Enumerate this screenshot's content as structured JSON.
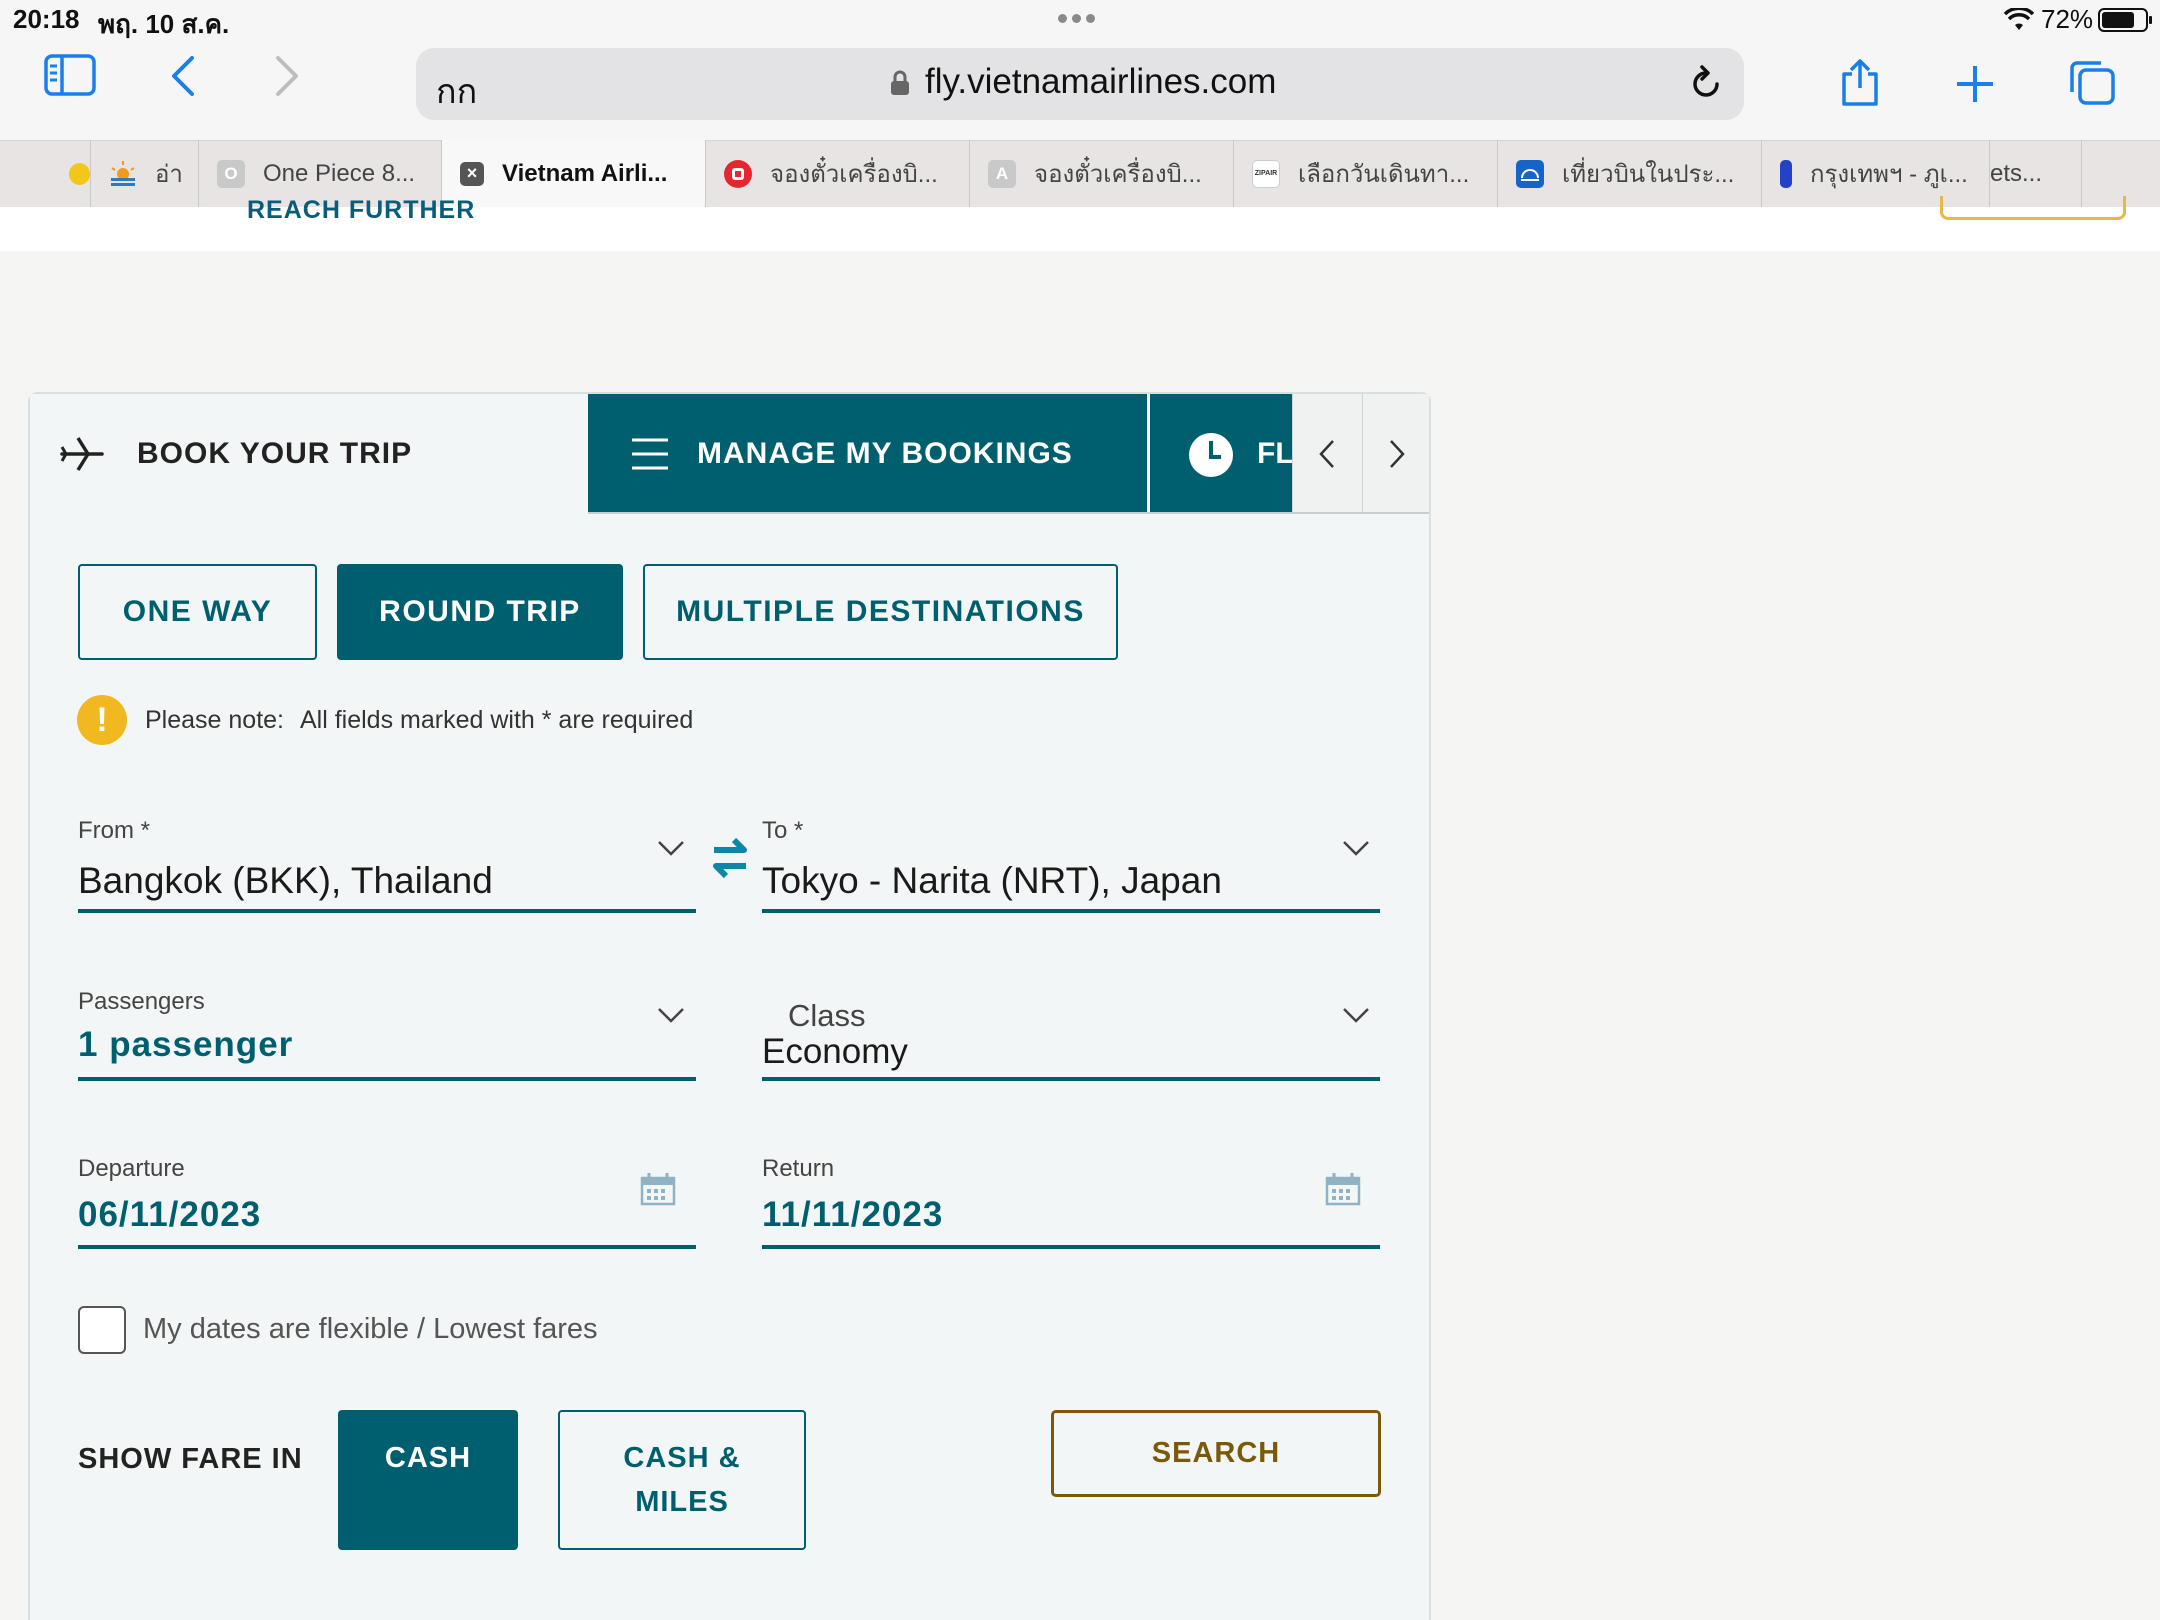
{
  "status_bar": {
    "time": "20:18",
    "date": "พฤ. 10 ส.ค.",
    "battery": "72%"
  },
  "browser": {
    "reader_label": "กก",
    "url": "fly.vietnamairlines.com",
    "tabs": [
      {
        "label": "อ่า",
        "favicon": "sun-icon"
      },
      {
        "label": "One Piece 8...",
        "favicon": "O"
      },
      {
        "label": "Vietnam Airli...",
        "favicon": "close-icon",
        "active": true
      },
      {
        "label": "จองตั๋วเครื่องบิ...",
        "favicon": "red-logo"
      },
      {
        "label": "จองตั๋วเครื่องบิ...",
        "favicon": "A"
      },
      {
        "label": "เลือกวันเดินทา...",
        "favicon": "zipair-logo"
      },
      {
        "label": "เที่ยวบินในประ...",
        "favicon": "blue-logo"
      },
      {
        "label": "กรุงเทพฯ - ภูเ...",
        "favicon": "flag-logo"
      },
      {
        "label": "ets...",
        "favicon": ""
      }
    ]
  },
  "header": {
    "tagline": "REACH FURTHER"
  },
  "widget": {
    "tabs": {
      "book": "BOOK YOUR TRIP",
      "manage": "MANAGE MY BOOKINGS",
      "flight": "FL"
    },
    "trip_types": {
      "one_way": "ONE WAY",
      "round_trip": "ROUND TRIP",
      "multi": "MULTIPLE DESTINATIONS"
    },
    "note": {
      "label": "Please note:",
      "text": "All fields marked with * are required"
    },
    "from": {
      "label": "From *",
      "value": "Bangkok (BKK), Thailand"
    },
    "to": {
      "label": "To *",
      "value": "Tokyo - Narita (NRT), Japan"
    },
    "passengers": {
      "label": "Passengers",
      "value": "1 passenger"
    },
    "class": {
      "label": "Class",
      "value": "Economy"
    },
    "departure": {
      "label": "Departure",
      "value": "06/11/2023"
    },
    "return": {
      "label": "Return",
      "value": "11/11/2023"
    },
    "flexible": "My dates are flexible / Lowest fares",
    "show_fare": "SHOW FARE IN",
    "cash": "CASH",
    "cash_miles": "CASH & MILES",
    "search": "SEARCH"
  },
  "colors": {
    "primary": "#005f6e",
    "gold": "#7a5a08",
    "note": "#f2b820"
  }
}
